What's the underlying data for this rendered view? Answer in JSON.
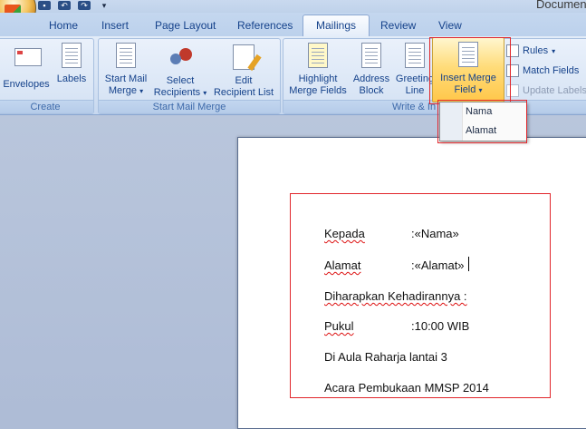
{
  "window": {
    "title": "Documen"
  },
  "tabs": [
    "Home",
    "Insert",
    "Page Layout",
    "References",
    "Mailings",
    "Review",
    "View"
  ],
  "active_tab": "Mailings",
  "ribbon": {
    "create": {
      "label": "Create",
      "envelopes": "Envelopes",
      "labels": "Labels"
    },
    "start_mail_merge": {
      "label": "Start Mail Merge",
      "start_line1": "Start Mail",
      "start_line2": "Merge",
      "select_line1": "Select",
      "select_line2": "Recipients",
      "edit_line1": "Edit",
      "edit_line2": "Recipient List"
    },
    "write_insert": {
      "label": "Write & In",
      "highlight_line1": "Highlight",
      "highlight_line2": "Merge Fields",
      "address_line1": "Address",
      "address_line2": "Block",
      "greeting_line1": "Greeting",
      "greeting_line2": "Line",
      "imf_line1": "Insert Merge",
      "imf_line2": "Field",
      "rules": "Rules",
      "match_fields": "Match Fields",
      "update_labels": "Update Labels"
    }
  },
  "merge_field_menu": [
    "Nama",
    "Alamat"
  ],
  "document": {
    "kepada_label": "Kepada",
    "kepada_value": ":«Nama»",
    "alamat_label": "Alamat",
    "alamat_value": ":«Alamat»",
    "diharapkan": "Diharapkan Kehadirannya :",
    "pukul_label": "Pukul",
    "pukul_value": ":10:00  WIB",
    "aula": "Di Aula Raharja lantai 3",
    "acara": "Acara Pembukaan MMSP 2014"
  },
  "colors": {
    "highlight_frame": "#e1262b",
    "active_button": "#ffc74a"
  }
}
